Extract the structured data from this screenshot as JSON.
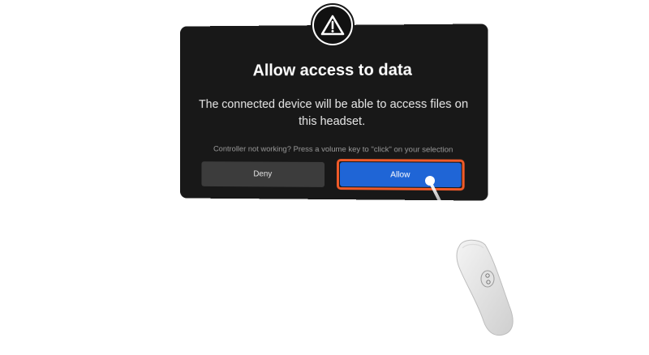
{
  "dialog": {
    "title": "Allow access to data",
    "message": "The connected device will be able to access files on this headset.",
    "hint": "Controller not working? Press a volume key to \"click\" on your selection",
    "deny_label": "Deny",
    "allow_label": "Allow",
    "icon": "warning-triangle-icon"
  },
  "colors": {
    "dialog_bg": "#181818",
    "allow_bg": "#1f65d6",
    "deny_bg": "#3c3c3c",
    "highlight": "#f05a28"
  },
  "controller": {
    "icon": "vr-controller-icon"
  }
}
